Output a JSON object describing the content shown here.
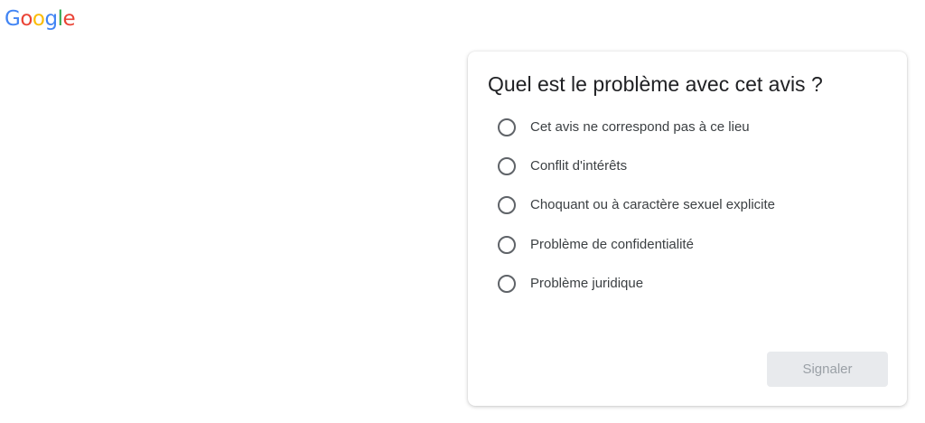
{
  "logo": {
    "letters": [
      {
        "char": "G",
        "color": "#4285F4"
      },
      {
        "char": "o",
        "color": "#EA4335"
      },
      {
        "char": "o",
        "color": "#FBBC05"
      },
      {
        "char": "g",
        "color": "#4285F4"
      },
      {
        "char": "l",
        "color": "#34A853"
      },
      {
        "char": "e",
        "color": "#EA4335"
      }
    ]
  },
  "dialog": {
    "title": "Quel est le problème avec cet avis ?",
    "options": [
      {
        "label": "Cet avis ne correspond pas à ce lieu",
        "selected": false
      },
      {
        "label": "Conflit d'intérêts",
        "selected": false
      },
      {
        "label": "Choquant ou à caractère sexuel explicite",
        "selected": false
      },
      {
        "label": "Problème de confidentialité",
        "selected": false
      },
      {
        "label": "Problème juridique",
        "selected": false
      }
    ],
    "submit_label": "Signaler",
    "submit_disabled": true
  }
}
